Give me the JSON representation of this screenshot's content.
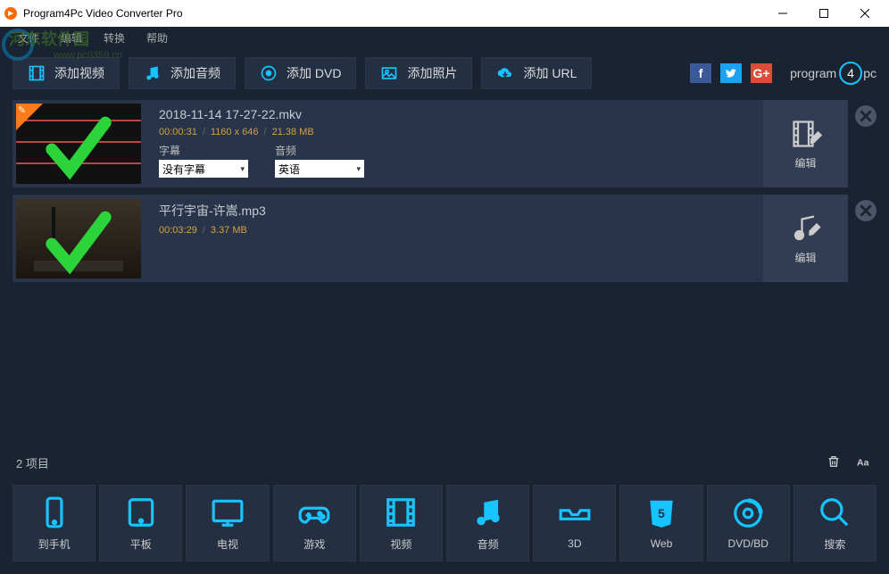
{
  "window": {
    "title": "Program4Pc Video Converter Pro"
  },
  "menu": {
    "file": "文件",
    "edit": "编辑",
    "convert": "转换",
    "help": "帮助"
  },
  "watermark": {
    "main": "河东软件园",
    "sub": "www.pc0359.cn"
  },
  "toolbar": {
    "add_video": "添加视频",
    "add_audio": "添加音频",
    "add_dvd": "添加 DVD",
    "add_photo": "添加照片",
    "add_url": "添加 URL"
  },
  "brand": {
    "text": "program",
    "num": "4",
    "suffix": "pc"
  },
  "items": [
    {
      "filename": "2018-11-14 17-27-22.mkv",
      "duration": "00:00:31",
      "resolution": "1160 x 646",
      "size": "21.38 MB",
      "subtitle_label": "字幕",
      "subtitle_value": "没有字幕",
      "audio_label": "音频",
      "audio_value": "英语",
      "edit_label": "编辑",
      "type": "video"
    },
    {
      "filename": "平行宇宙-许嵩.mp3",
      "duration": "00:03:29",
      "size": "3.37 MB",
      "edit_label": "编辑",
      "type": "audio"
    }
  ],
  "status": {
    "count_text": "2 项目"
  },
  "categories": {
    "phone": "到手机",
    "tablet": "平板",
    "tv": "电视",
    "game": "游戏",
    "video": "视频",
    "audio": "音频",
    "three_d": "3D",
    "web": "Web",
    "dvd": "DVD/BD",
    "search": "搜索"
  },
  "colors": {
    "accent": "#17c4ff",
    "bg": "#1a2332",
    "panel": "#27344a"
  }
}
